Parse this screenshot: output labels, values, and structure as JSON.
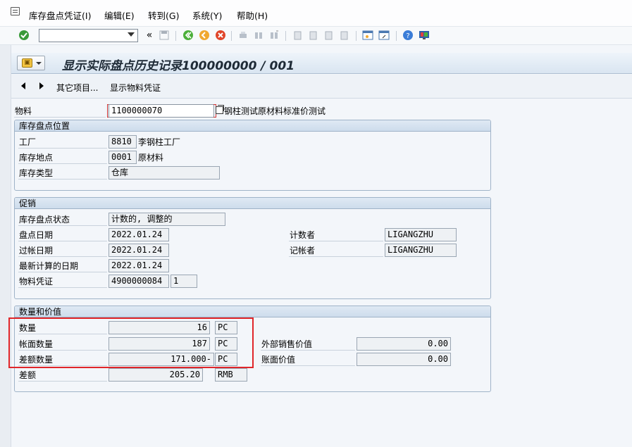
{
  "menu": {
    "items": [
      "库存盘点凭证(I)",
      "编辑(E)",
      "转到(G)",
      "系统(Y)",
      "帮助(H)"
    ]
  },
  "toolbar": {
    "command_value": "",
    "icons": [
      "enter-icon",
      "command-field",
      "back-arrows-icon",
      "save-icon",
      "back-icon",
      "exit-icon",
      "cancel-icon",
      "print-icon",
      "find-icon",
      "find-next-icon",
      "first-page-icon",
      "prev-page-icon",
      "next-page-icon",
      "last-page-icon",
      "new-session-icon",
      "shortcut-icon",
      "help-icon",
      "layout-icon"
    ],
    "back_glyph": "«"
  },
  "title": "显示实际盘点历史记录100000000 / 001",
  "appbar": {
    "other_items": "其它项目...",
    "show_material_doc": "显示物料凭证"
  },
  "material": {
    "label": "物料",
    "value": "1100000070",
    "description": "钢柱测试原材料标准价测试"
  },
  "location_group": {
    "title": "库存盘点位置",
    "plant_label": "工厂",
    "plant_value": "8810",
    "plant_desc": "李钢柱工厂",
    "sloc_label": "库存地点",
    "sloc_value": "0001",
    "sloc_desc": "原材料",
    "stock_type_label": "库存类型",
    "stock_type_value": "仓库"
  },
  "promo_group": {
    "title": "促销",
    "status_label": "库存盘点状态",
    "status_value": "计数的, 调整的",
    "count_date_label": "盘点日期",
    "count_date_value": "2022.01.24",
    "post_date_label": "过帐日期",
    "post_date_value": "2022.01.24",
    "recalc_date_label": "最新计算的日期",
    "recalc_date_value": "2022.01.24",
    "matdoc_label": "物料凭证",
    "matdoc_value": "4900000084",
    "matdoc_item": "1",
    "counter_label": "计数者",
    "counter_value": "LIGANGZHU",
    "poster_label": "记帐者",
    "poster_value": "LIGANGZHU"
  },
  "qty_group": {
    "title": "数量和价值",
    "qty_label": "数量",
    "qty_value": "16",
    "qty_unit": "PC",
    "book_qty_label": "帐面数量",
    "book_qty_value": "187",
    "book_qty_unit": "PC",
    "diff_qty_label": "差额数量",
    "diff_qty_value": "171.000-",
    "diff_qty_unit": "PC",
    "diff_label": "差额",
    "diff_value": "205.20",
    "diff_unit": "RMB",
    "ext_sales_label": "外部销售价值",
    "ext_sales_value": "0.00",
    "book_value_label": "账面价值",
    "book_value_value": "0.00"
  },
  "colors": {
    "highlight_border": "#e0262a",
    "group_border": "#9fb3c8"
  }
}
